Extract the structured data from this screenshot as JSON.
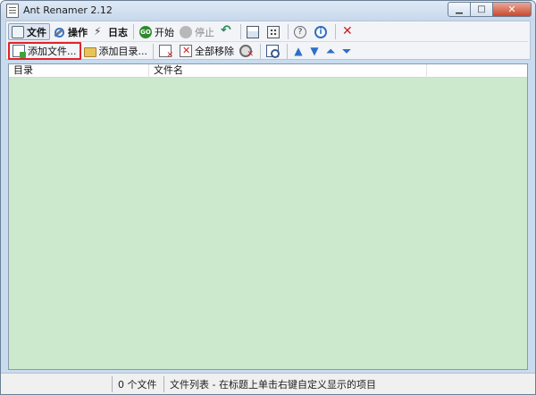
{
  "window": {
    "title": "Ant Renamer 2.12"
  },
  "toolbar_top": {
    "file": "文件",
    "actions": "操作",
    "log": "日志",
    "start": "开始",
    "stop": "停止"
  },
  "toolbar_bottom": {
    "add_files": "添加文件...",
    "add_folder": "添加目录...",
    "remove_all": "全部移除"
  },
  "list": {
    "columns": [
      "目录",
      "文件名",
      ""
    ]
  },
  "status": {
    "left": "",
    "count": "0 个文件",
    "hint": "文件列表 - 在标题上单击右键自定义显示的项目"
  },
  "colors": {
    "list_background": "#cce8cd",
    "highlight_border": "#e0242a",
    "accent_blue": "#2d6fc7"
  },
  "icons": {
    "go": "GO"
  }
}
